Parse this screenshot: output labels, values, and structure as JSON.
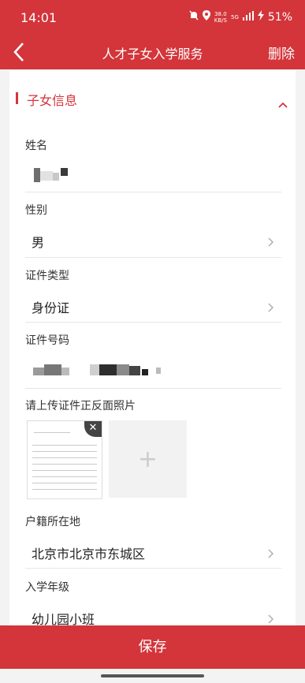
{
  "status_bar": {
    "time": "14:01",
    "net_speed_top": "38.0",
    "net_speed_bottom": "KB/S",
    "network": "5G",
    "battery": "51%"
  },
  "nav": {
    "title": "人才子女入学服务",
    "delete_label": "删除"
  },
  "section": {
    "title": "子女信息"
  },
  "fields": {
    "name": {
      "label": "姓名"
    },
    "gender": {
      "label": "性别",
      "value": "男"
    },
    "id_type": {
      "label": "证件类型",
      "value": "身份证"
    },
    "id_number": {
      "label": "证件号码"
    },
    "upload": {
      "label": "请上传证件正反面照片"
    },
    "household": {
      "label": "户籍所在地",
      "value": "北京市北京市东城区"
    },
    "grade": {
      "label": "入学年级",
      "value": "幼儿园小班"
    }
  },
  "save_label": "保存",
  "colors": {
    "brand": "#d3353a"
  },
  "icons": [
    "back-arrow-icon",
    "chevron-up-icon",
    "chevron-right-icon",
    "close-icon",
    "plus-icon"
  ]
}
